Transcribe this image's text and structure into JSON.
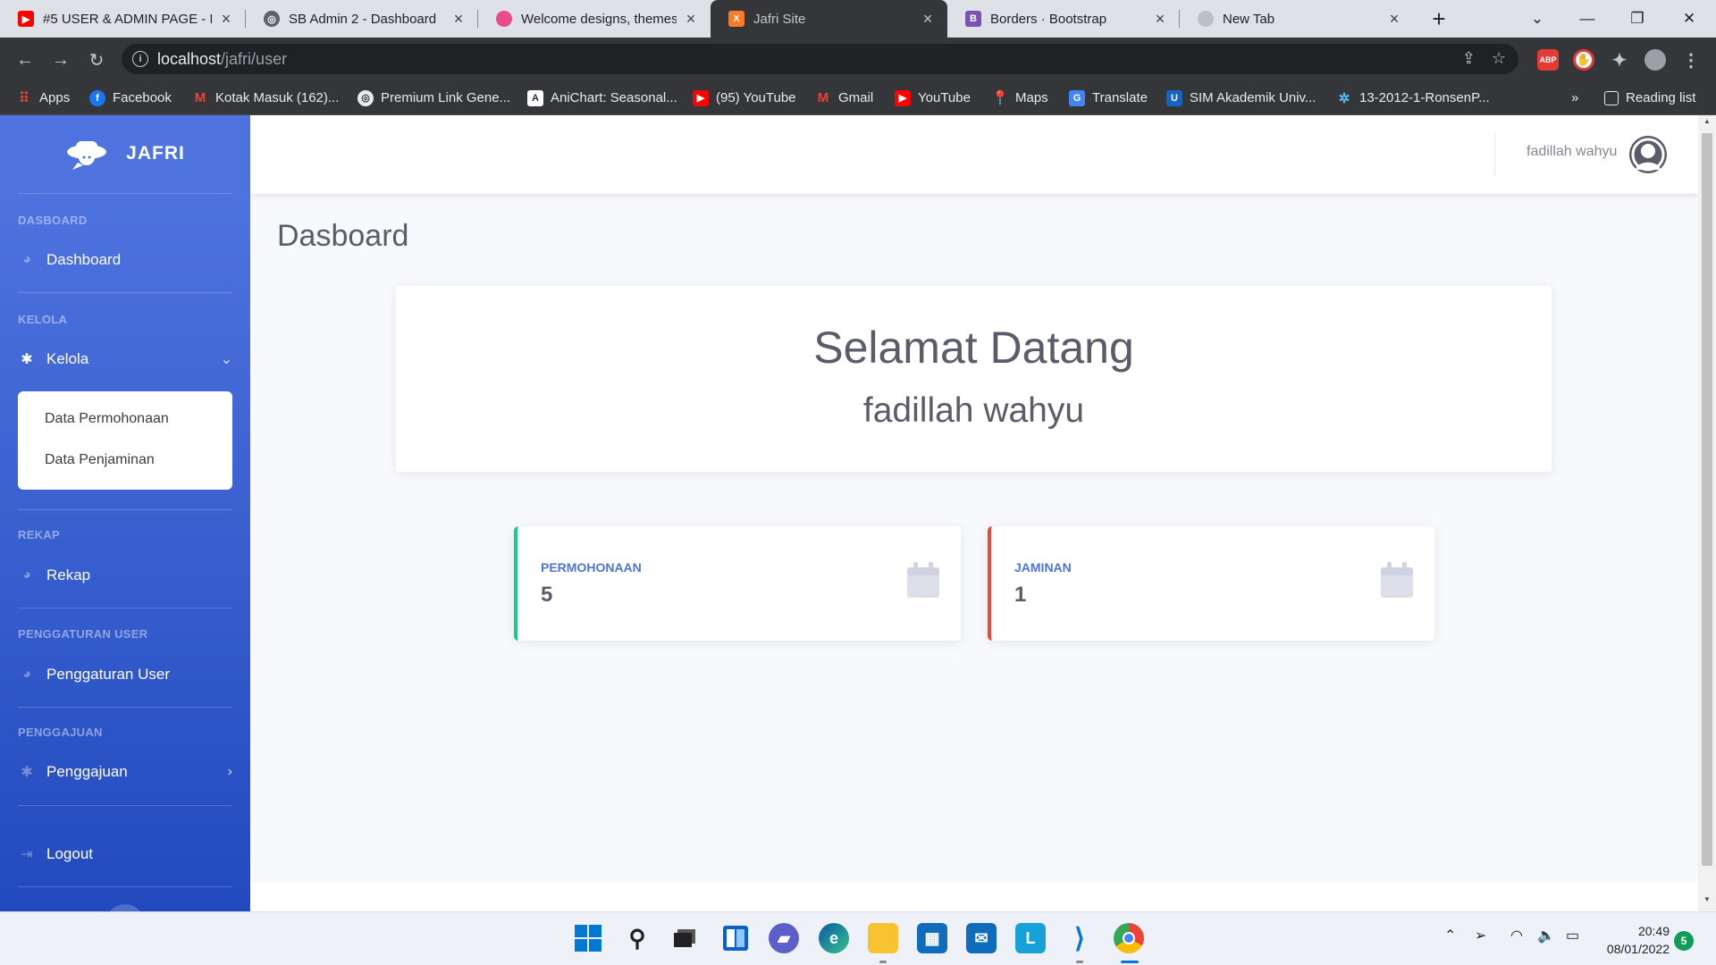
{
  "browser": {
    "tabs": [
      {
        "title": "#5 USER & ADMIN PAGE - P",
        "icon": "youtube-icon",
        "color": "#ff0000"
      },
      {
        "title": "SB Admin 2 - Dashboard",
        "icon": "globe-icon",
        "color": "#5f6368"
      },
      {
        "title": "Welcome designs, themes, t",
        "icon": "dribbble-icon",
        "color": "#ea4c89"
      },
      {
        "title": "Jafri Site",
        "icon": "xampp-icon",
        "color": "#fb7a24"
      },
      {
        "title": "Borders · Bootstrap",
        "icon": "bootstrap-icon",
        "color": "#7952b3"
      },
      {
        "title": "New Tab",
        "icon": "chrome-newtab-icon",
        "color": "#bdc1c6"
      }
    ],
    "url_host": "localhost",
    "url_path": "/jafri/user",
    "bookmarks": [
      {
        "label": "Apps",
        "icon": "apps-grid-icon",
        "color": "#ea4335"
      },
      {
        "label": "Facebook",
        "icon": "facebook-icon",
        "color": "#1877f2"
      },
      {
        "label": "Kotak Masuk (162)...",
        "icon": "gmail-icon",
        "color": "#ea4335"
      },
      {
        "label": "Premium Link Gene...",
        "icon": "globe-icon",
        "color": "#e8eaed"
      },
      {
        "label": "AniChart: Seasonal...",
        "icon": "anichart-icon",
        "color": "#3db4f2"
      },
      {
        "label": "(95) YouTube",
        "icon": "youtube-icon",
        "color": "#ff0000"
      },
      {
        "label": "Gmail",
        "icon": "gmail-icon",
        "color": "#ea4335"
      },
      {
        "label": "YouTube",
        "icon": "youtube-icon",
        "color": "#ff0000"
      },
      {
        "label": "Maps",
        "icon": "maps-pin-icon",
        "color": "#34a853"
      },
      {
        "label": "Translate",
        "icon": "translate-icon",
        "color": "#4285f4"
      },
      {
        "label": "SIM Akademik Univ...",
        "icon": "university-icon",
        "color": "#1565c0"
      },
      {
        "label": "13-2012-1-RonsenP...",
        "icon": "molecule-icon",
        "color": "#4fc3f7"
      }
    ],
    "reading_list": "Reading list",
    "more_bookmarks": "»"
  },
  "sidebar": {
    "brand": "JAFRI",
    "sections": [
      {
        "heading": "DASBOARD",
        "item": "Dashboard"
      },
      {
        "heading": "KELOLA",
        "item": "Kelola"
      },
      {
        "heading": "REKAP",
        "item": "Rekap"
      },
      {
        "heading": "PENGGATURAN USER",
        "item": "Penggaturan User"
      },
      {
        "heading": "PENGGAJUAN",
        "item": "Penggajuan"
      }
    ],
    "kelola_submenu": [
      "Data Permohonaan",
      "Data Penjaminan"
    ],
    "logout": "Logout"
  },
  "topbar": {
    "user_name": "fadillah wahyu"
  },
  "main": {
    "page_title": "Dasboard",
    "welcome_title": "Selamat Datang",
    "welcome_name": "fadillah wahyu",
    "stats": [
      {
        "label": "PERMOHONAAN",
        "value": "5",
        "accent": "#1cc88a"
      },
      {
        "label": "JAMINAN",
        "value": "1",
        "accent": "#e74a3b"
      }
    ]
  },
  "taskbar": {
    "time": "20:49",
    "date": "08/01/2022",
    "notifications": "5"
  }
}
